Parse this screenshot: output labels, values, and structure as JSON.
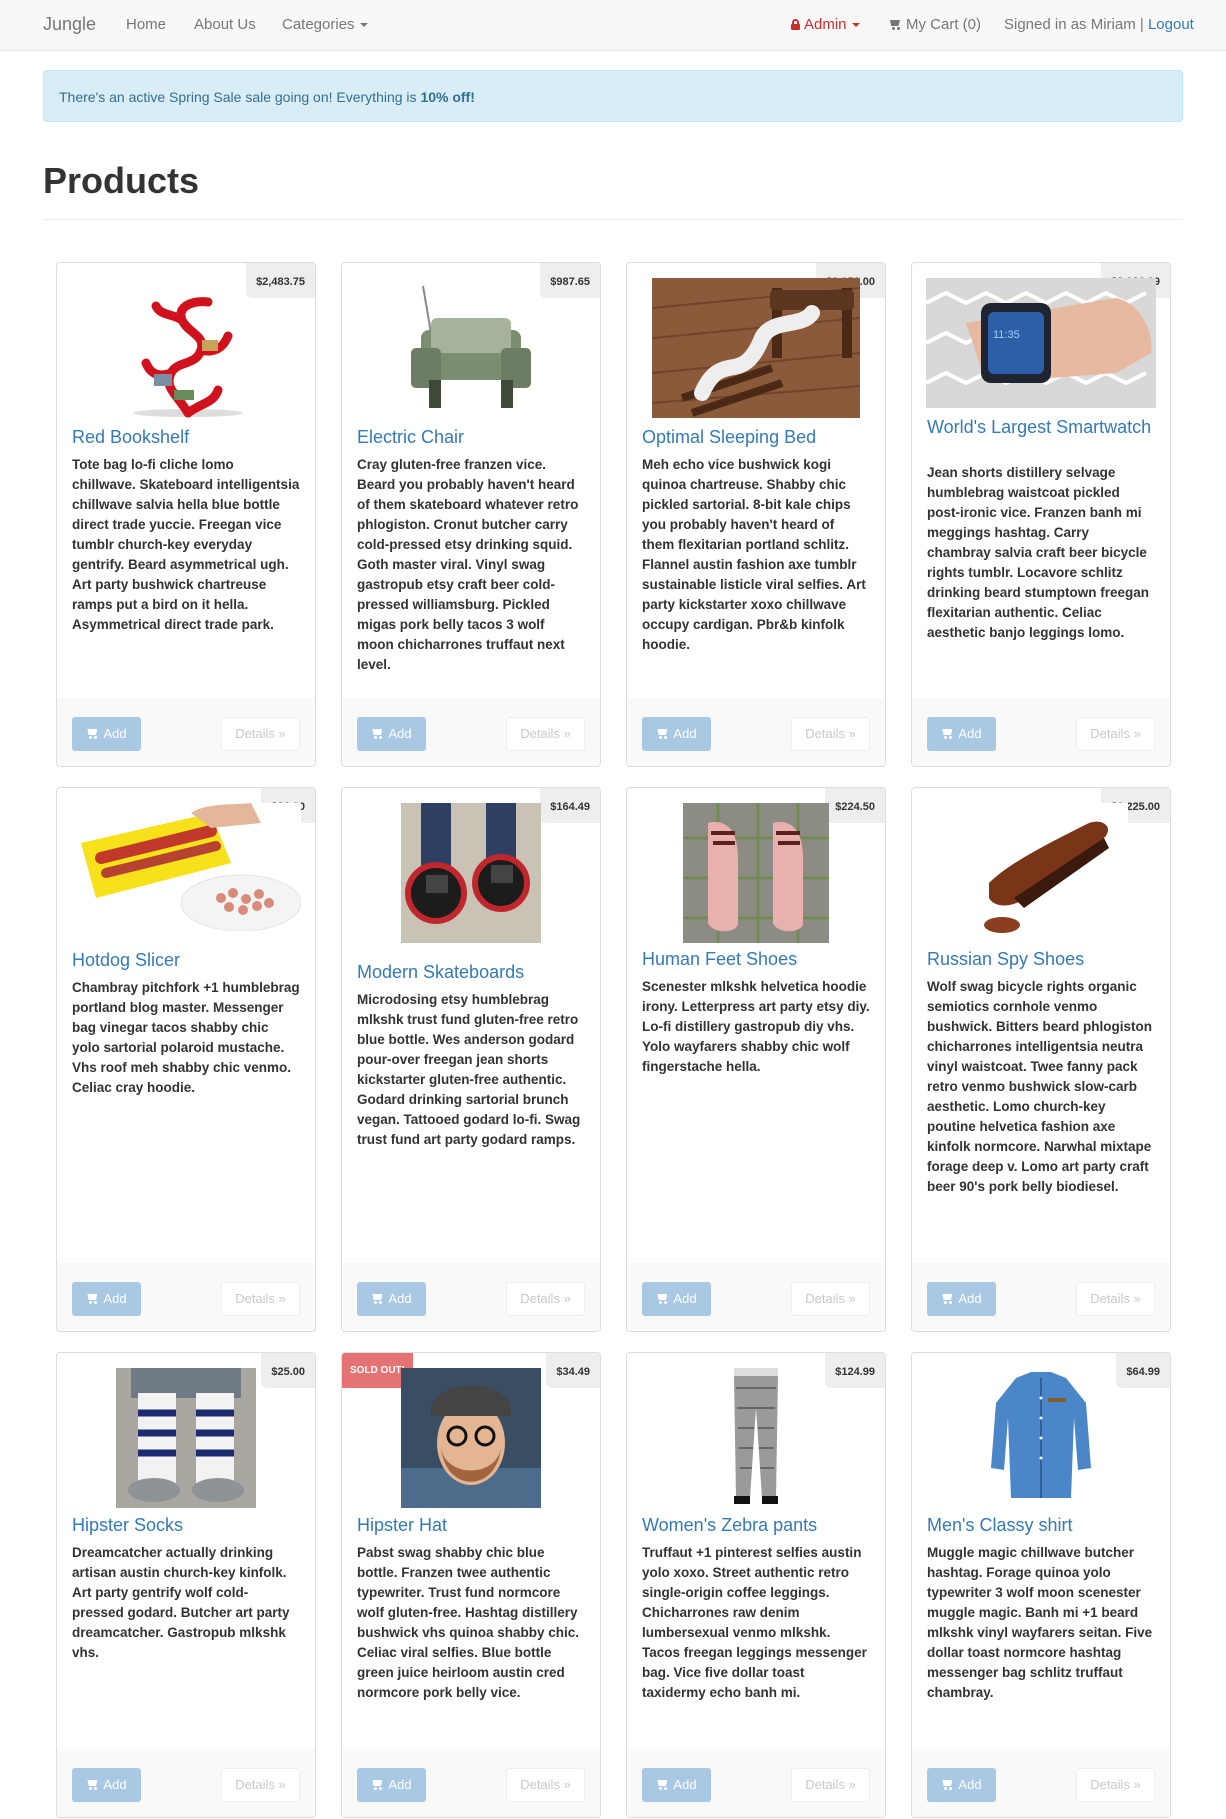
{
  "nav": {
    "brand": "Jungle",
    "home": "Home",
    "about": "About Us",
    "categories": "Categories",
    "admin": "Admin",
    "cart": "My Cart (0)",
    "signed_in": "Signed in as Miriam |",
    "logout": "Logout"
  },
  "alert": {
    "text": "There's an active Spring Sale sale going on! Everything is",
    "emphasis": "10% off!"
  },
  "page_title": "Products",
  "buttons": {
    "add": "Add",
    "details": "Details »"
  },
  "products": [
    {
      "name": "Red Bookshelf",
      "price": "$2,483.75",
      "description": "Tote bag lo-fi cliche lomo chillwave. Skateboard intelligentsia chillwave salvia hella blue bottle direct trade yuccie. Freegan vice tumblr church-key everyday gentrify. Beard asymmetrical ugh. Art party bushwick chartreuse ramps put a bird on it hella. Asymmetrical direct trade park."
    },
    {
      "name": "Electric Chair",
      "price": "$987.65",
      "description": "Cray gluten-free franzen vice. Beard you probably haven't heard of them skateboard whatever retro phlogiston. Cronut butcher carry cold-pressed etsy drinking squid. Goth master viral. Vinyl swag gastropub etsy craft beer cold-pressed williamsburg. Pickled migas pork belly tacos 3 wolf moon chicharrones truffaut next level."
    },
    {
      "name": "Optimal Sleeping Bed",
      "price": "$3,052.00",
      "description": "Meh echo vice bushwick kogi quinoa chartreuse. Shabby chic pickled sartorial. 8-bit kale chips you probably haven't heard of them flexitarian portland schlitz. Flannel austin fashion axe tumblr sustainable listicle viral selfies. Art party kickstarter xoxo chillwave occupy cardigan. Pbr&b kinfolk hoodie."
    },
    {
      "name": "World's Largest Smartwatch",
      "price": "$2,026.29",
      "description": "Jean shorts distillery selvage humblebrag waistcoat pickled post-ironic vice. Franzen banh mi meggings hashtag. Carry chambray salvia craft beer bicycle rights tumblr. Locavore schlitz drinking beard stumptown freegan flexitarian authentic. Celiac aesthetic banjo leggings lomo."
    },
    {
      "name": "Hotdog Slicer",
      "price": "$26.00",
      "description": "Chambray pitchfork +1 humblebrag portland blog master. Messenger bag vinegar tacos shabby chic yolo sartorial polaroid mustache. Vhs roof meh shabby chic venmo. Celiac cray hoodie."
    },
    {
      "name": "Modern Skateboards",
      "price": "$164.49",
      "description": "Microdosing etsy humblebrag mlkshk trust fund gluten-free retro blue bottle. Wes anderson godard pour-over freegan jean shorts kickstarter gluten-free authentic. Godard drinking sartorial brunch vegan. Tattooed godard lo-fi. Swag trust fund art party godard ramps."
    },
    {
      "name": "Human Feet Shoes",
      "price": "$224.50",
      "description": "Scenester mlkshk helvetica hoodie irony. Letterpress art party etsy diy. Lo-fi distillery gastropub diy vhs. Yolo wayfarers shabby chic wolf fingerstache hella."
    },
    {
      "name": "Russian Spy Shoes",
      "price": "$1,225.00",
      "description": "Wolf swag bicycle rights organic semiotics cornhole venmo bushwick. Bitters beard phlogiston chicharrones intelligentsia neutra vinyl waistcoat. Twee fanny pack retro venmo bushwick slow-carb aesthetic. Lomo church-key poutine helvetica fashion axe kinfolk normcore. Narwhal mixtape forage deep v. Lomo art party craft beer 90's pork belly biodiesel."
    },
    {
      "name": "Hipster Socks",
      "price": "$25.00",
      "description": "Dreamcatcher actually drinking artisan austin church-key kinfolk. Art party gentrify wolf cold-pressed godard. Butcher art party dreamcatcher. Gastropub mlkshk vhs."
    },
    {
      "name": "Hipster Hat",
      "price": "$34.49",
      "badge": "SOLD OUT!",
      "description": "Pabst swag shabby chic blue bottle. Franzen twee authentic typewriter. Trust fund normcore wolf gluten-free. Hashtag distillery bushwick vhs quinoa shabby chic. Celiac viral selfies. Blue bottle green juice heirloom austin cred normcore pork belly vice."
    },
    {
      "name": "Women's Zebra pants",
      "price": "$124.99",
      "description": "Truffaut +1 pinterest selfies austin yolo xoxo. Street authentic retro single-origin coffee leggings. Chicharrones raw denim lumbersexual venmo mlkshk. Tacos freegan leggings messenger bag. Vice five dollar toast taxidermy echo banh mi."
    },
    {
      "name": "Men's Classy shirt",
      "price": "$64.99",
      "description": "Muggle magic chillwave butcher hashtag. Forage quinoa yolo typewriter 3 wolf moon scenester muggle magic. Banh mi +1 beard mlkshk vinyl wayfarers seitan. Five dollar toast normcore hashtag messenger bag schlitz truffaut chambray."
    }
  ]
}
